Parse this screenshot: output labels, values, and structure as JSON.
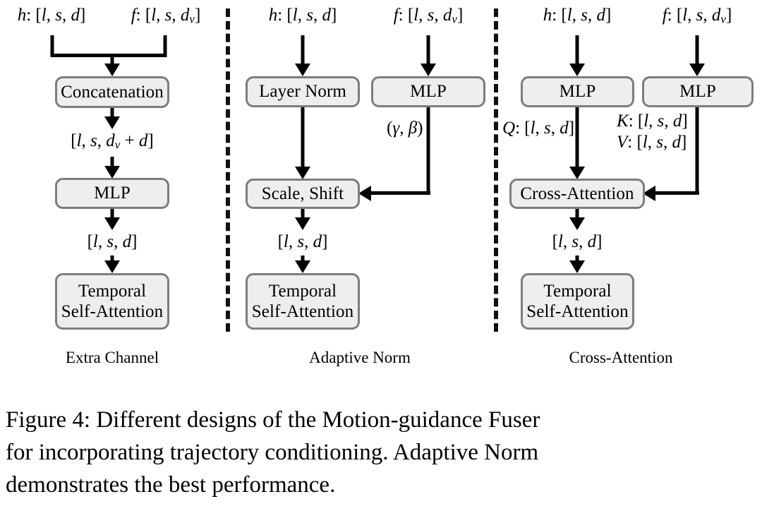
{
  "figure": {
    "caption_line1": "Figure 4: Different designs of the Motion-guidance Fuser",
    "caption_line2": "for incorporating trajectory conditioning. Adaptive Norm",
    "caption_line3": "demonstrates the best performance."
  },
  "columns": [
    {
      "id": "extra-channel",
      "caption": "Extra Channel",
      "inputs": [
        {
          "id": "h-input",
          "text": "h: [l, s, d]"
        },
        {
          "id": "f-input",
          "text": "f: [l, s, dv]"
        }
      ],
      "nodes": [
        {
          "id": "concatenation",
          "label": "Concatenation"
        },
        {
          "id": "mlp",
          "label": "MLP"
        },
        {
          "id": "temporal-self-attention",
          "line1": "Temporal",
          "line2": "Self-Attention"
        }
      ],
      "edge_labels": [
        {
          "id": "concat-out-shape",
          "text": "[l, s, dv + d]"
        },
        {
          "id": "mlp-out-shape",
          "text": "[l, s, d]"
        }
      ]
    },
    {
      "id": "adaptive-norm",
      "caption": "Adaptive Norm",
      "inputs": [
        {
          "id": "h-input",
          "text": "h: [l, s, d]"
        },
        {
          "id": "f-input",
          "text": "f: [l, s, dv]"
        }
      ],
      "nodes": [
        {
          "id": "layer-norm",
          "label": "Layer Norm"
        },
        {
          "id": "mlp",
          "label": "MLP"
        },
        {
          "id": "scale-shift",
          "label": "Scale, Shift"
        },
        {
          "id": "temporal-self-attention",
          "line1": "Temporal",
          "line2": "Self-Attention"
        }
      ],
      "edge_labels": [
        {
          "id": "gamma-beta",
          "text": "(γ, β)"
        },
        {
          "id": "scale-shift-out-shape",
          "text": "[l, s, d]"
        }
      ]
    },
    {
      "id": "cross-attention",
      "caption": "Cross-Attention",
      "inputs": [
        {
          "id": "h-input",
          "text": "h: [l, s, d]"
        },
        {
          "id": "f-input",
          "text": "f: [l, s, dv]"
        }
      ],
      "nodes": [
        {
          "id": "mlp-query",
          "label": "MLP"
        },
        {
          "id": "mlp-keyvalue",
          "label": "MLP"
        },
        {
          "id": "cross-attention",
          "label": "Cross-Attention"
        },
        {
          "id": "temporal-self-attention",
          "line1": "Temporal",
          "line2": "Self-Attention"
        }
      ],
      "edge_labels": [
        {
          "id": "q-shape",
          "text": "Q: [l, s, d]"
        },
        {
          "id": "k-shape",
          "text": "K: [l, s, d]"
        },
        {
          "id": "v-shape",
          "text": "V: [l, s, d]"
        },
        {
          "id": "cross-attn-out-shape",
          "text": "[l, s, d]"
        }
      ]
    }
  ],
  "style": {
    "node_fill": "#eeeeee",
    "node_border": "#7d7d7d",
    "line_color": "#000000",
    "background": "#ffffff"
  }
}
